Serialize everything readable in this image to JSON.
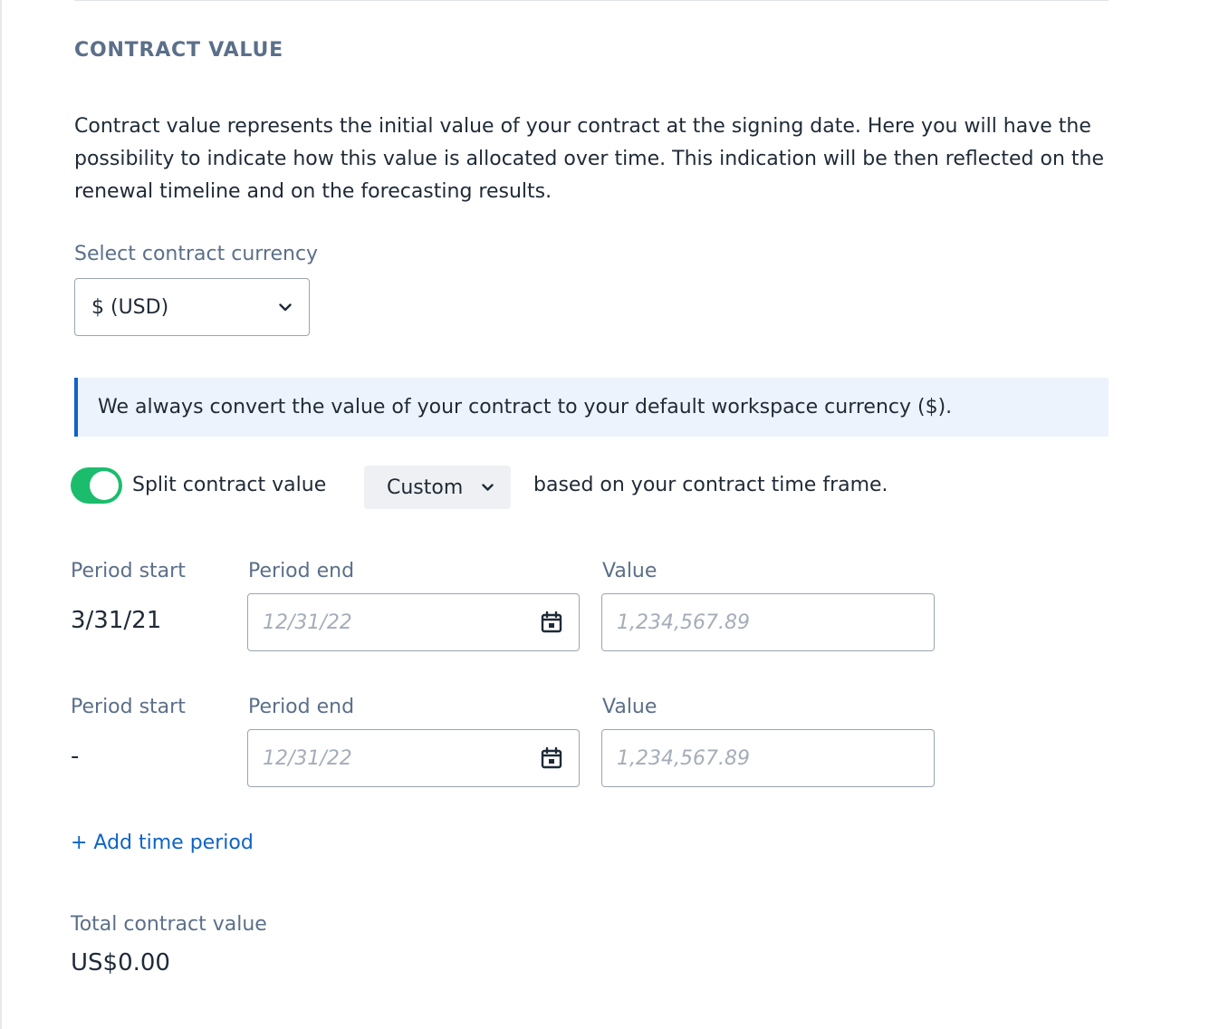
{
  "section": {
    "title": "CONTRACT VALUE",
    "description": "Contract value represents the initial value of your contract at the signing date. Here you will have the possibility to indicate how this value is allocated over time. This indication will be then reflected on the renewal timeline and on the forecasting results."
  },
  "currency": {
    "label": "Select contract currency",
    "selected": "$ (USD)",
    "icon": "chevron-down-icon"
  },
  "info_banner": {
    "text": "We always convert the value of your contract to your default workspace currency ($).",
    "accent_color": "#0e63c7",
    "background": "#edf3fc"
  },
  "split": {
    "toggle_on": true,
    "toggle_color": "#1bbd6d",
    "label": "Split contract value",
    "mode": "Custom",
    "suffix": "based on your contract time frame."
  },
  "periods": [
    {
      "start_label": "Period start",
      "end_label": "Period end",
      "value_label": "Value",
      "start_value": "3/31/21",
      "end_placeholder": "12/31/22",
      "value_placeholder": "1,234,567.89"
    },
    {
      "start_label": "Period start",
      "end_label": "Period end",
      "value_label": "Value",
      "start_value": "-",
      "end_placeholder": "12/31/22",
      "value_placeholder": "1,234,567.89"
    }
  ],
  "add_period": {
    "label": "+ Add time period",
    "color": "#0e63c7"
  },
  "total": {
    "label": "Total contract value",
    "value": "US$0.00"
  }
}
